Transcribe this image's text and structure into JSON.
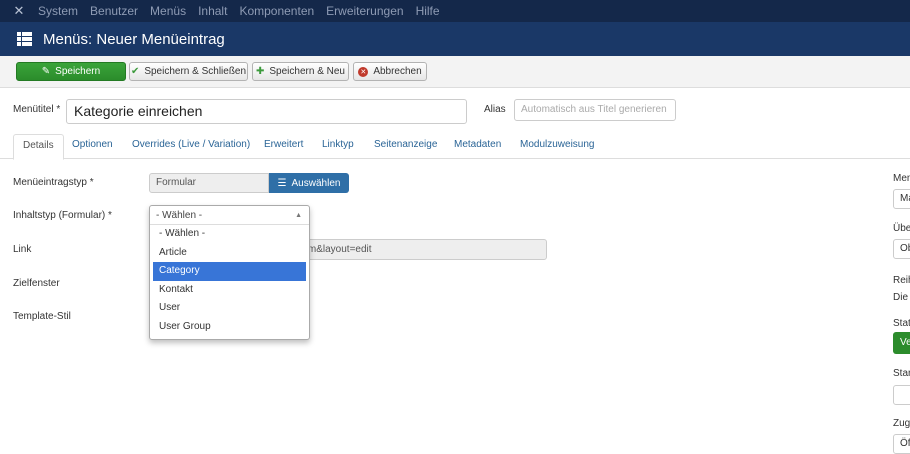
{
  "topnav": {
    "logo_icon": "joomla-icon",
    "items": [
      "System",
      "Benutzer",
      "Menüs",
      "Inhalt",
      "Komponenten",
      "Erweiterungen",
      "Hilfe"
    ]
  },
  "header": {
    "icon": "list-icon",
    "title": "Menüs: Neuer Menüeintrag"
  },
  "toolbar": {
    "save": "Speichern",
    "save_close": "Speichern & Schließen",
    "save_new": "Speichern & Neu",
    "cancel": "Abbrechen"
  },
  "form": {
    "title_label": "Menütitel *",
    "title_value": "Kategorie einreichen",
    "alias_label": "Alias",
    "alias_placeholder": "Automatisch aus Titel generieren"
  },
  "tabs": [
    "Details",
    "Optionen",
    "Overrides (Live / Variation)",
    "Erweitert",
    "Linktyp",
    "Seitenanzeige",
    "Metadaten",
    "Modulzuweisung"
  ],
  "details": {
    "menu_type_label": "Menüeintragstyp *",
    "menu_type_value": "Formular",
    "select_button": "Auswählen",
    "content_type_label": "Inhaltstyp (Formular) *",
    "link_label": "Link",
    "link_value": "orm&layout=edit",
    "target_label": "Zielfenster",
    "template_label": "Template-Stil"
  },
  "dropdown": {
    "selected": "- Wählen -",
    "options": [
      "- Wählen -",
      "Article",
      "Category",
      "Kontakt",
      "User",
      "User Group"
    ],
    "highlighted": "Category"
  },
  "sidebar": {
    "labels": [
      "Men",
      "Übe",
      "Reih",
      "Die",
      "Stat",
      "Star",
      "Zug"
    ],
    "box1": "Ma",
    "box2": "Ob",
    "status_button": "Ve",
    "box3": "",
    "box4": "Öf"
  }
}
